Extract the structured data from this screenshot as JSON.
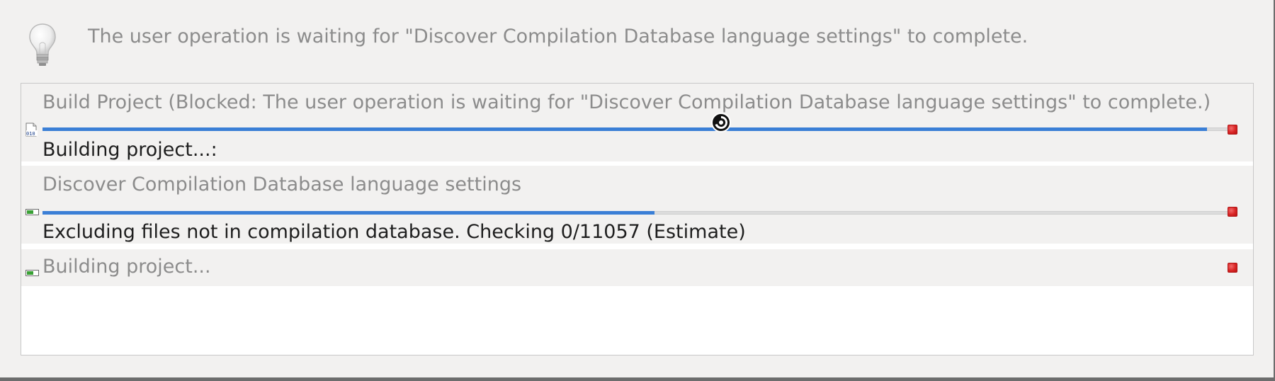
{
  "hint": {
    "icon": "lightbulb-icon",
    "text": "The user operation is waiting for \"Discover Compilation Database language settings\" to complete."
  },
  "jobs": [
    {
      "title": "Build Project (Blocked: The user operation is waiting for \"Discover Compilation Database language settings\" to complete.)",
      "status": "Building project...:",
      "icon": "binary-file-icon",
      "progress": 0.98
    },
    {
      "title": "Discover Compilation Database language settings",
      "status": "Excluding files not in compilation database. Checking 0/11057 (Estimate)",
      "icon": "progress-job-icon",
      "progress": 0.515
    },
    {
      "title": "Building project...",
      "status": "",
      "icon": "progress-job-icon"
    }
  ],
  "colors": {
    "progress_fill": "#3b7fd6",
    "stop": "#d82424",
    "muted_text": "#8c8c8c"
  },
  "cursor": "busy-cursor-icon"
}
